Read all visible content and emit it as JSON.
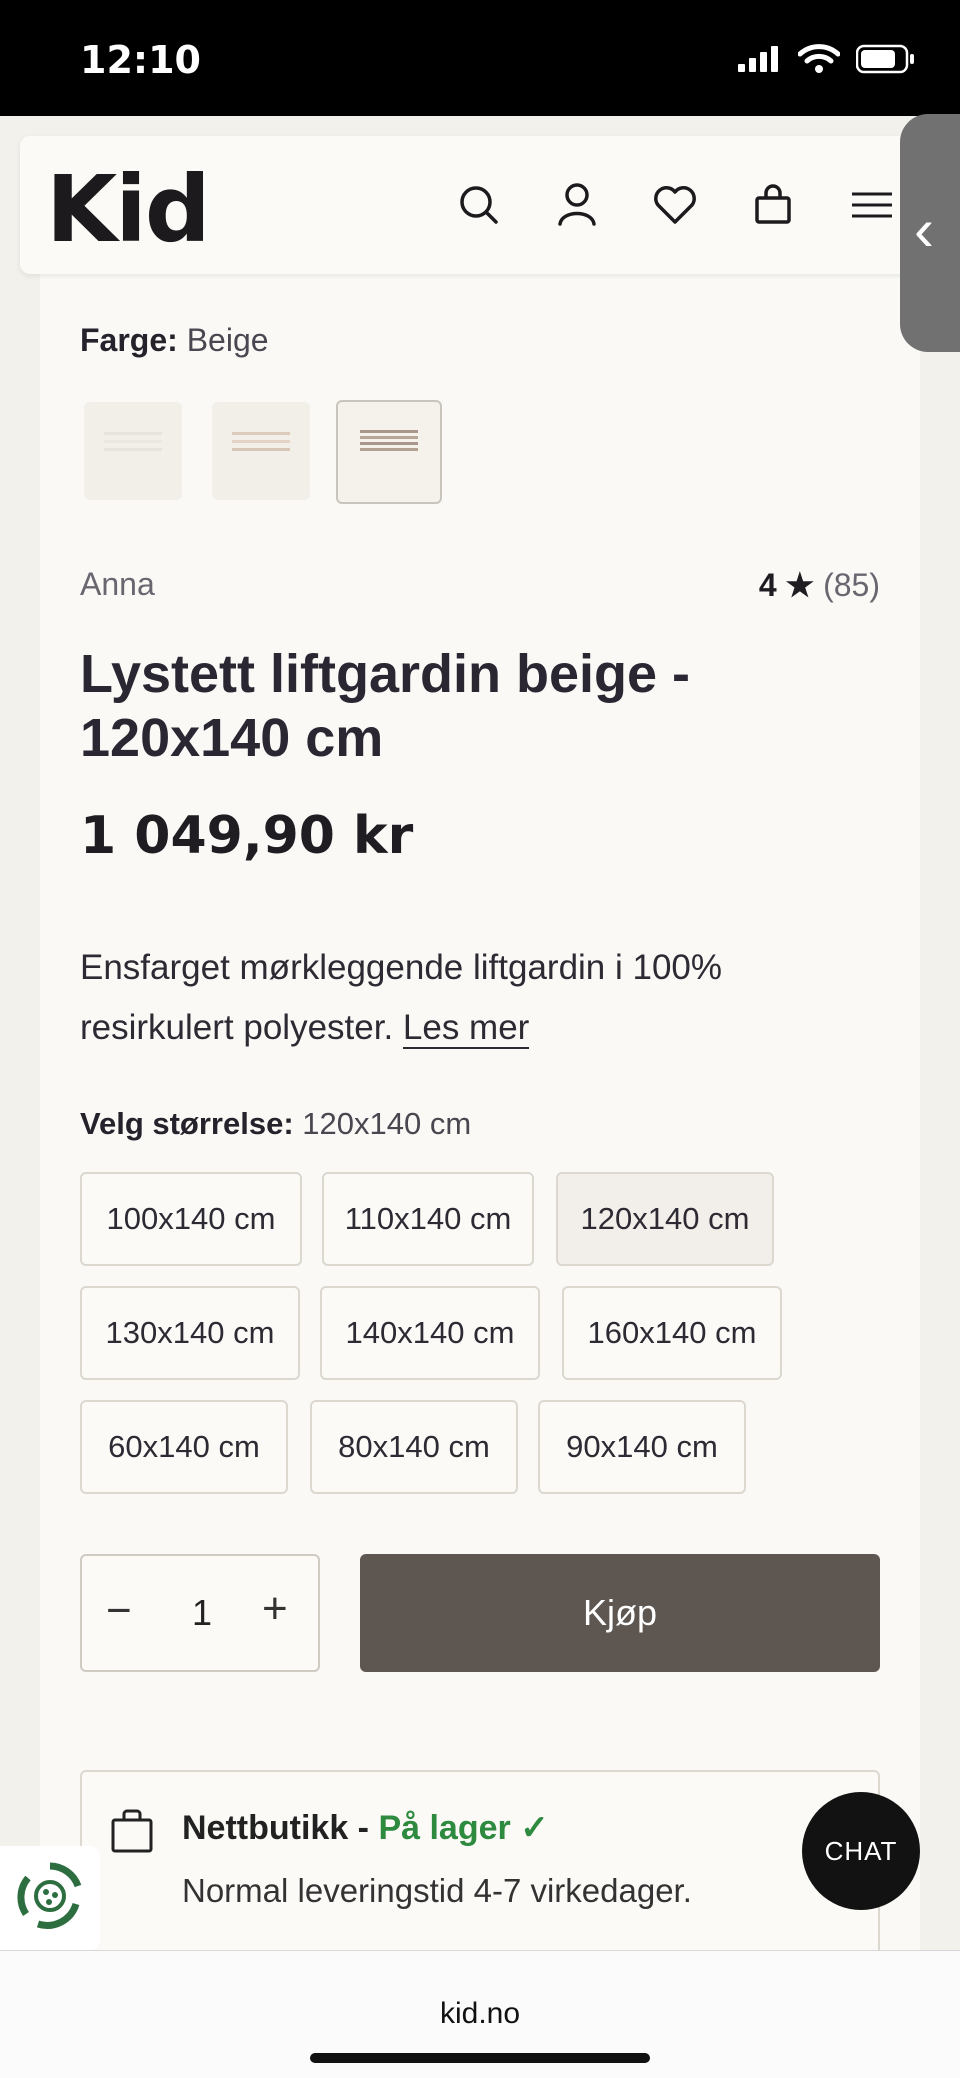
{
  "status_bar": {
    "time": "12:10"
  },
  "header": {
    "logo": "Kid",
    "icons": [
      "search-icon",
      "account-icon",
      "wishlist-icon",
      "cart-icon",
      "menu-icon"
    ]
  },
  "product": {
    "color_label": "Farge:",
    "color_value": "Beige",
    "brand": "Anna",
    "rating_value": "4",
    "rating_star": "★",
    "rating_count": "(85)",
    "title": "Lystett liftgardin beige - 120x140 cm",
    "price": "1 049,90 kr",
    "description": "Ensfarget mørkleggende liftgardin i 100% resirkulert polyester.",
    "read_more": "Les mer",
    "size_label": "Velg størrelse:",
    "size_value": "120x140 cm",
    "sizes": [
      "100x140 cm",
      "110x140 cm",
      "120x140 cm",
      "130x140 cm",
      "140x140 cm",
      "160x140 cm",
      "60x140 cm",
      "80x140 cm",
      "90x140 cm"
    ],
    "selected_size": "120x140 cm",
    "quantity": "1",
    "minus": "−",
    "plus": "+",
    "buy_label": "Kjøp"
  },
  "stock": {
    "store_label": "Nettbutikk -",
    "status": "På lager",
    "check": "✓",
    "delivery": "Normal leveringstid 4-7 virkedager."
  },
  "chat_label": "CHAT",
  "browser": {
    "url": "kid.no"
  },
  "colors": {
    "buy_button": "#5d5651",
    "in_stock": "#2d8a3e"
  }
}
